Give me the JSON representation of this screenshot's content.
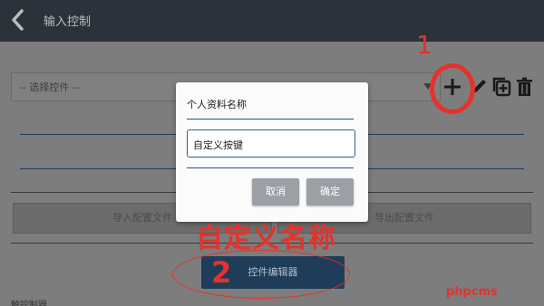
{
  "header": {
    "title": "输入控制"
  },
  "controls": {
    "select_placeholder": "-- 选择控件 --"
  },
  "buttons": {
    "import": "导入配置文件",
    "export": "导出配置文件",
    "editor": "控件编辑器"
  },
  "bottom": {
    "text": "触控制器"
  },
  "dialog": {
    "title": "个人资料名称",
    "input_value": "自定义按键",
    "cancel": "取消",
    "ok": "确定"
  },
  "annotations": {
    "step1": "1",
    "step2": "2",
    "caption": "自定义名称",
    "watermark": "phpcms"
  },
  "colors": {
    "annotation_red": "#e5322b",
    "topbar": "#2b3239",
    "editor_button": "#1f3d58"
  }
}
